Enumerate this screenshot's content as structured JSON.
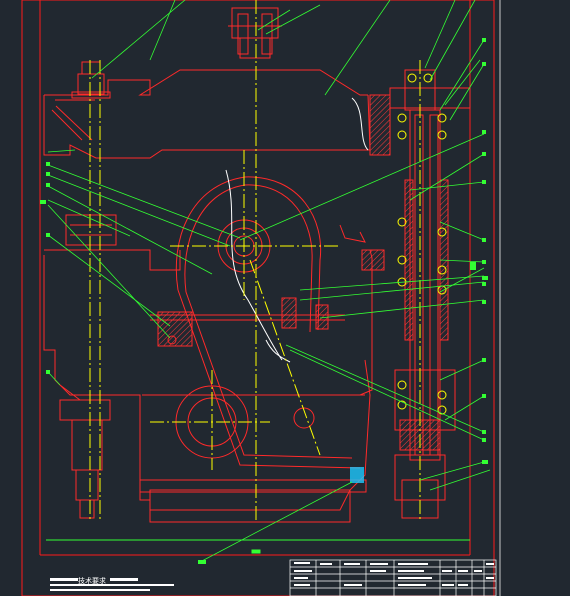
{
  "viewport": {
    "width": 570,
    "height": 596
  },
  "colors": {
    "background": "#212830",
    "frame": "#ff1a1a",
    "outline": "#ff2a2a",
    "leader": "#33ff33",
    "centerline": "#ffff00",
    "text": "#ffffff",
    "hatch": "#ff3a3a",
    "solid_detail": "#1ec8ff"
  },
  "drawing": {
    "technical_notes_title": "技术要求",
    "title_block": {
      "cell_text_color": "#ffffff"
    }
  }
}
